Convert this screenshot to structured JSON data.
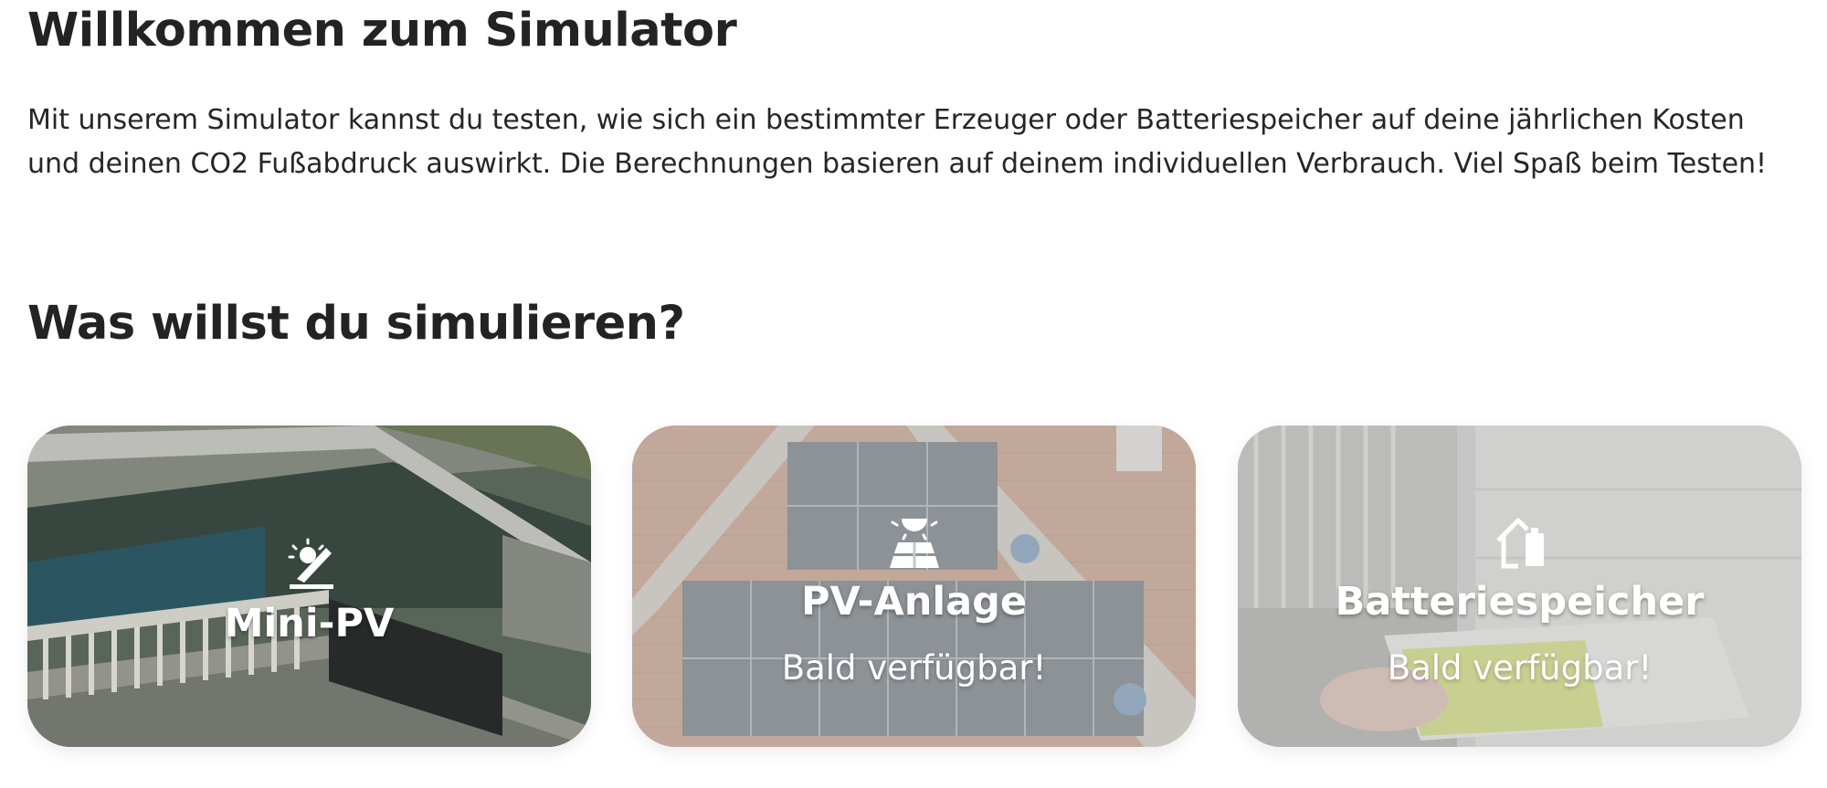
{
  "header": {
    "title": "Willkommen zum Simulator",
    "intro": "Mit unserem Simulator kannst du testen, wie sich ein bestimmter Erzeuger oder Batteriespeicher auf deine jährlichen Kosten und deinen CO2 Fußabdruck auswirkt. Die Berechnungen basieren auf deinem individuellen Verbrauch. Viel Spaß beim Testen!"
  },
  "section": {
    "title": "Was willst du simulieren?"
  },
  "cards": [
    {
      "title": "Mini-PV",
      "subtitle": "",
      "icon": "balcony-solar-icon",
      "available": true
    },
    {
      "title": "PV-Anlage",
      "subtitle": "Bald verfügbar!",
      "icon": "solar-panel-icon",
      "available": false
    },
    {
      "title": "Batteriespeicher",
      "subtitle": "Bald verfügbar!",
      "icon": "home-battery-icon",
      "available": false
    }
  ]
}
